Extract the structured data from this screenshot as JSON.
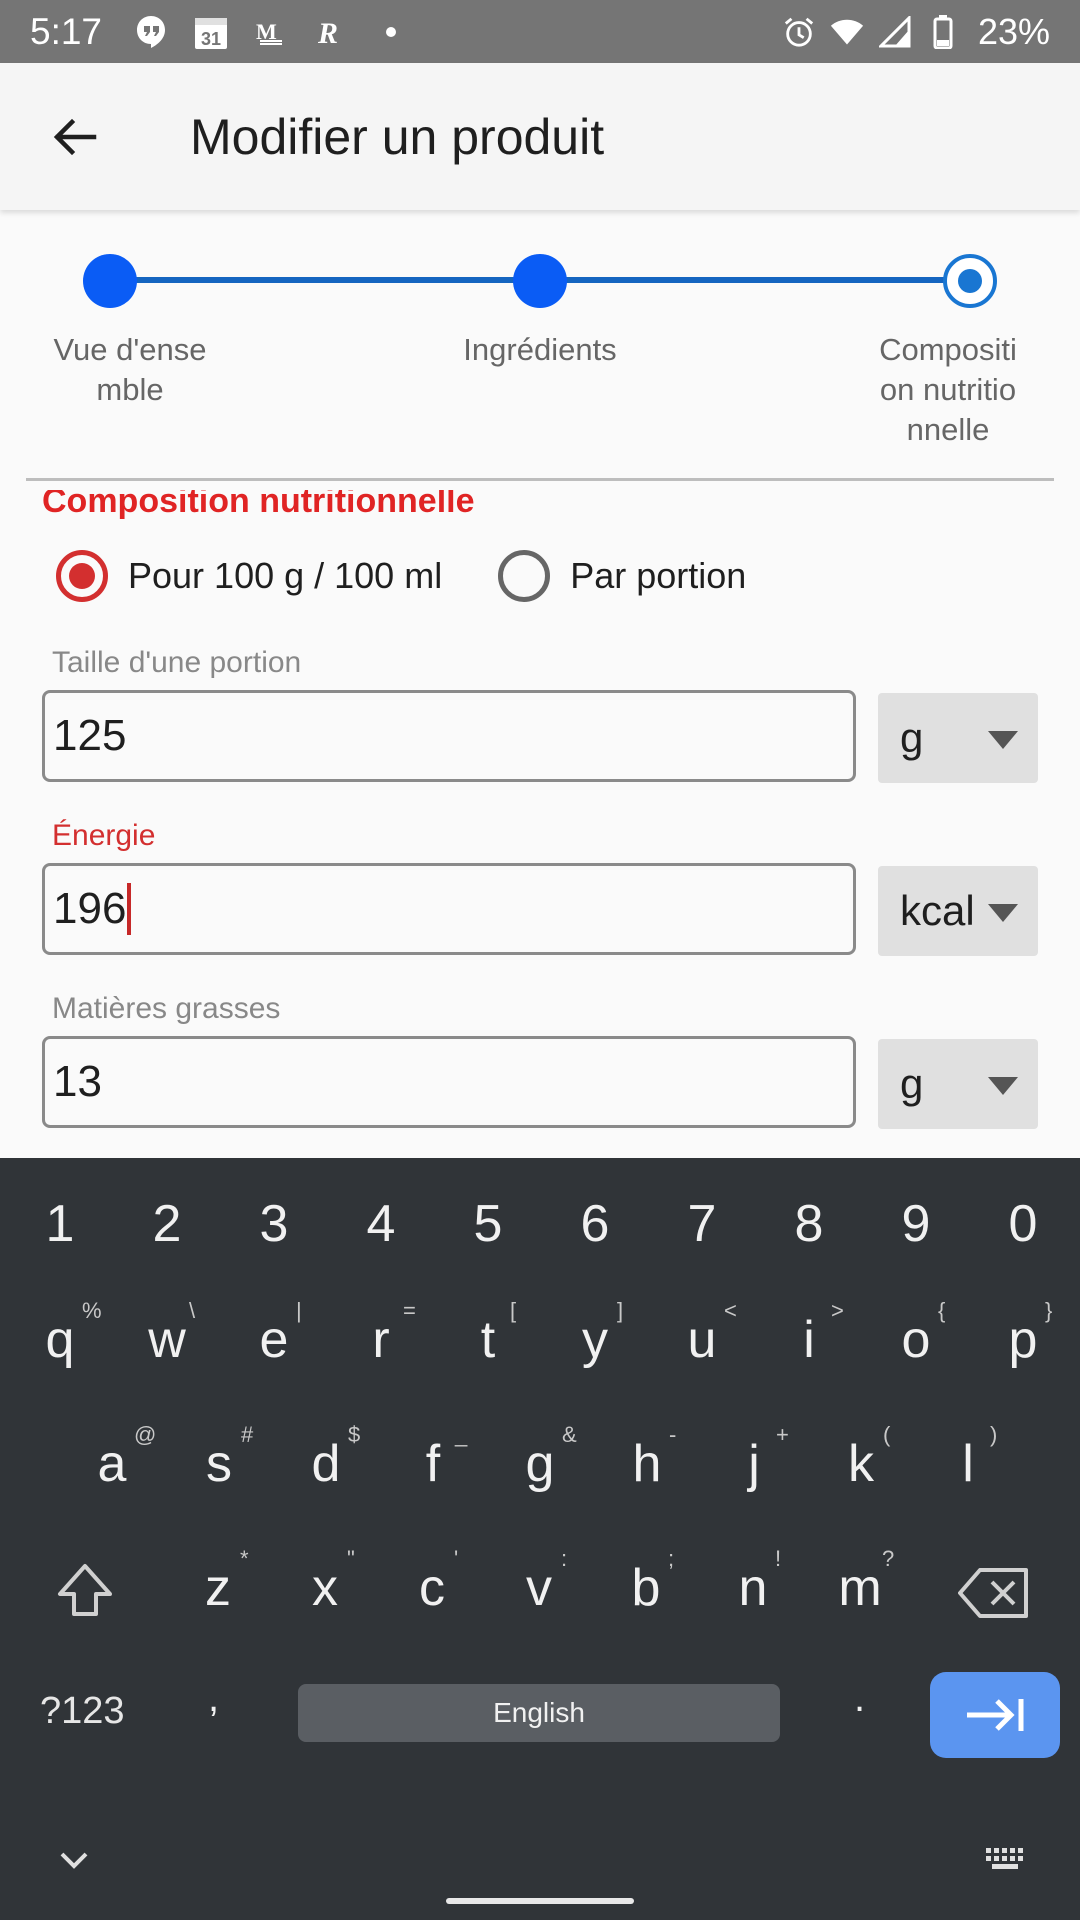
{
  "status_bar": {
    "time": "5:17",
    "battery": "23%",
    "left_icons": [
      "hangouts-icon",
      "calendar-icon",
      "gmail-icon",
      "r-app-icon",
      "dot-icon"
    ],
    "calendar_day": "31",
    "right_icons": [
      "alarm-icon",
      "wifi-icon",
      "signal-icon",
      "battery-icon"
    ]
  },
  "app_bar": {
    "title": "Modifier un produit",
    "back_icon": "back-arrow-icon"
  },
  "stepper": {
    "steps": [
      {
        "label": "Vue d'ense mble",
        "lines": [
          "Vue d'ense",
          "mble"
        ],
        "state": "done"
      },
      {
        "label": "Ingrédients",
        "lines": [
          "Ingrédients"
        ],
        "state": "done"
      },
      {
        "label": "Compositi on nutritio nnelle",
        "lines": [
          "Compositi",
          "on nutritio",
          "nnelle"
        ],
        "state": "current"
      }
    ]
  },
  "form": {
    "section_title": "Composition nutritionnelle",
    "radio_options": [
      {
        "label": "Pour 100 g / 100 ml",
        "checked": true
      },
      {
        "label": "Par portion",
        "checked": false
      }
    ],
    "fields": [
      {
        "label": "Taille d'une portion",
        "value": "125",
        "unit": "g",
        "focused": false
      },
      {
        "label": "Énergie",
        "value": "196",
        "unit": "kcal",
        "focused": true
      },
      {
        "label": "Matières grasses",
        "value": "13",
        "unit": "g",
        "focused": false
      }
    ]
  },
  "keyboard": {
    "number_row": [
      "1",
      "2",
      "3",
      "4",
      "5",
      "6",
      "7",
      "8",
      "9",
      "0"
    ],
    "row1": [
      {
        "key": "q",
        "hint": "%"
      },
      {
        "key": "w",
        "hint": "\\"
      },
      {
        "key": "e",
        "hint": "|"
      },
      {
        "key": "r",
        "hint": "="
      },
      {
        "key": "t",
        "hint": "["
      },
      {
        "key": "y",
        "hint": "]"
      },
      {
        "key": "u",
        "hint": "<"
      },
      {
        "key": "i",
        "hint": ">"
      },
      {
        "key": "o",
        "hint": "{"
      },
      {
        "key": "p",
        "hint": "}"
      }
    ],
    "row2": [
      {
        "key": "a",
        "hint": "@"
      },
      {
        "key": "s",
        "hint": "#"
      },
      {
        "key": "d",
        "hint": "$"
      },
      {
        "key": "f",
        "hint": "_"
      },
      {
        "key": "g",
        "hint": "&"
      },
      {
        "key": "h",
        "hint": "-"
      },
      {
        "key": "j",
        "hint": "+"
      },
      {
        "key": "k",
        "hint": "("
      },
      {
        "key": "l",
        "hint": ")"
      }
    ],
    "row3": [
      {
        "key": "z",
        "hint": "*"
      },
      {
        "key": "x",
        "hint": "\""
      },
      {
        "key": "c",
        "hint": "'"
      },
      {
        "key": "v",
        "hint": ":"
      },
      {
        "key": "b",
        "hint": ";"
      },
      {
        "key": "n",
        "hint": "!"
      },
      {
        "key": "m",
        "hint": "?"
      }
    ],
    "symbols_key": "?123",
    "comma_key": ",",
    "space_label": "English",
    "period_key": ".",
    "accent_color": "#5b95f0"
  }
}
